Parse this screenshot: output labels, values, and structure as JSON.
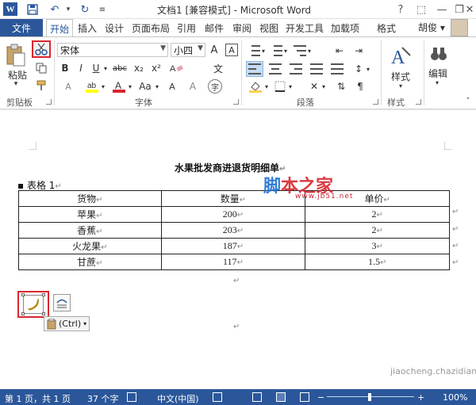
{
  "window": {
    "title": "文档1 [兼容模式] - Microsoft Word",
    "app_icon_letter": "W",
    "quick_access": {
      "save_icon": "save-icon",
      "undo_icon": "undo-icon",
      "redo_icon": "redo-icon"
    },
    "controls": {
      "help": "?",
      "minimize": "—",
      "restore": "❐",
      "close": "✕"
    }
  },
  "tabs": {
    "file": "文件",
    "items": [
      "开始",
      "插入",
      "设计",
      "页面布局",
      "引用",
      "邮件",
      "审阅",
      "视图",
      "开发工具",
      "加载项",
      "格式"
    ],
    "active": "开始",
    "user": "胡俊"
  },
  "ribbon": {
    "clipboard": {
      "paste": "粘贴",
      "label": "剪贴板"
    },
    "font": {
      "name": "宋体",
      "size": "小四",
      "label": "字体",
      "bold": "B",
      "italic": "I",
      "underline": "U",
      "strike": "abc",
      "sub": "x₂",
      "sup": "x²",
      "grow": "A",
      "shrink": "A",
      "change_case": "Aa",
      "wen": "文",
      "highlight": "A",
      "fontcolor": "A",
      "aa": "Aa",
      "circle": "字"
    },
    "paragraph": {
      "label": "段落"
    },
    "styles": {
      "button": "样式",
      "label": "样式"
    },
    "editing": {
      "button": "编辑"
    }
  },
  "document": {
    "title": "水果批发商进退货明细单",
    "caption": "表格 1",
    "table": {
      "headers": [
        "货物",
        "数量",
        "单价"
      ],
      "rows": [
        [
          "苹果",
          "200",
          "2"
        ],
        [
          "香蕉",
          "203",
          "2"
        ],
        [
          "火龙果",
          "187",
          "3"
        ],
        [
          "甘蔗",
          "117",
          "1.5"
        ]
      ]
    },
    "watermark": {
      "main_blue": "脚",
      "main_red": "本之家",
      "url": "www.jb51.net"
    },
    "paste_options": "(Ctrl)"
  },
  "status": {
    "page": "第 1 页，共 1 页",
    "words": "37 个字",
    "language": "中文(中国)",
    "zoom": "100%"
  },
  "site_watermark": "jiaocheng.chazidian.com"
}
